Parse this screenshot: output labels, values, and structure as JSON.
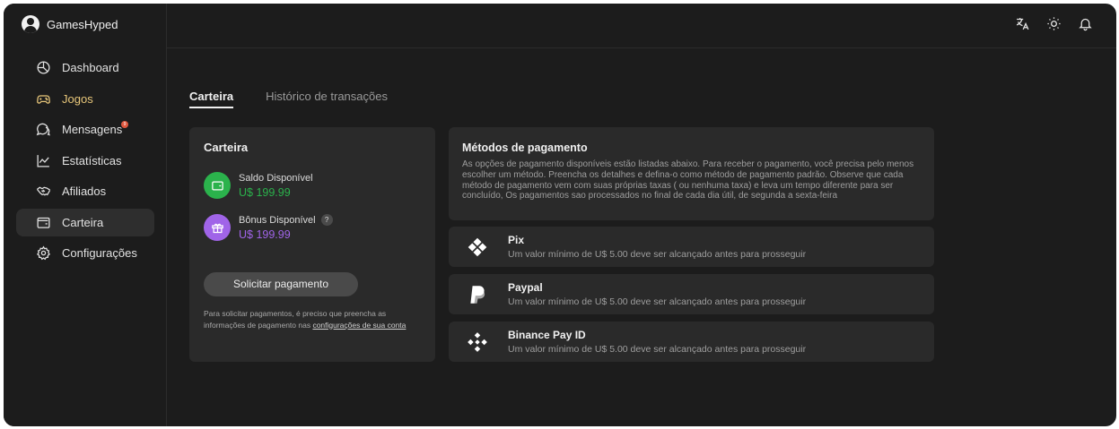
{
  "brand": {
    "name": "GamesHyped"
  },
  "sidebar": {
    "items": [
      {
        "label": "Dashboard",
        "icon": "dashboard-icon"
      },
      {
        "label": "Jogos",
        "icon": "gamepad-icon"
      },
      {
        "label": "Mensagens",
        "icon": "chat-icon",
        "badge": "9"
      },
      {
        "label": "Estatísticas",
        "icon": "chart-icon"
      },
      {
        "label": "Afiliados",
        "icon": "handshake-icon"
      },
      {
        "label": "Carteira",
        "icon": "wallet-icon"
      },
      {
        "label": "Configurações",
        "icon": "gear-icon"
      }
    ],
    "active_item": "Carteira"
  },
  "topbar": {
    "icons": [
      "translate-icon",
      "sun-icon",
      "bell-icon"
    ]
  },
  "tabs": [
    {
      "label": "Carteira",
      "active": true
    },
    {
      "label": "Histórico de transações",
      "active": false
    }
  ],
  "wallet": {
    "title": "Carteira",
    "available": {
      "label": "Saldo Disponível",
      "value": "U$ 199.99",
      "color": "#2bb24c"
    },
    "bonus": {
      "label": "Bônus Disponível",
      "value": "U$ 199.99",
      "color": "#a064e8",
      "help": "?"
    },
    "button": "Solicitar pagamento",
    "note_prefix": "Para solicitar pagamentos, é preciso que preencha as informações de pagamento nas ",
    "note_link": "configurações de sua conta"
  },
  "methods": {
    "title": "Métodos de pagamento",
    "description": "As opções de pagamento disponíveis estão listadas abaixo. Para receber o pagamento, você precisa pelo menos escolher um método. Preencha os detalhes e defina-o como método de pagamento padrão. Observe que cada método de pagamento vem com suas próprias taxas ( ou nenhuma taxa) e leva um tempo diferente para ser concluído, Os pagamentos sao processados no final de cada dia útil, de segunda a sexta-feira",
    "items": [
      {
        "name": "Pix",
        "subtitle": "Um valor mínimo de U$ 5.00 deve ser alcançado antes para prosseguir",
        "icon": "pix-icon"
      },
      {
        "name": "Paypal",
        "subtitle": "Um valor mínimo de U$ 5.00 deve ser alcançado antes para prosseguir",
        "icon": "paypal-icon"
      },
      {
        "name": "Binance Pay ID",
        "subtitle": "Um valor mínimo de U$ 5.00 deve ser alcançado antes para prosseguir",
        "icon": "binance-icon"
      }
    ]
  },
  "colors": {
    "accent_active_nav": "#e8c77a",
    "badge": "#e0573e"
  }
}
